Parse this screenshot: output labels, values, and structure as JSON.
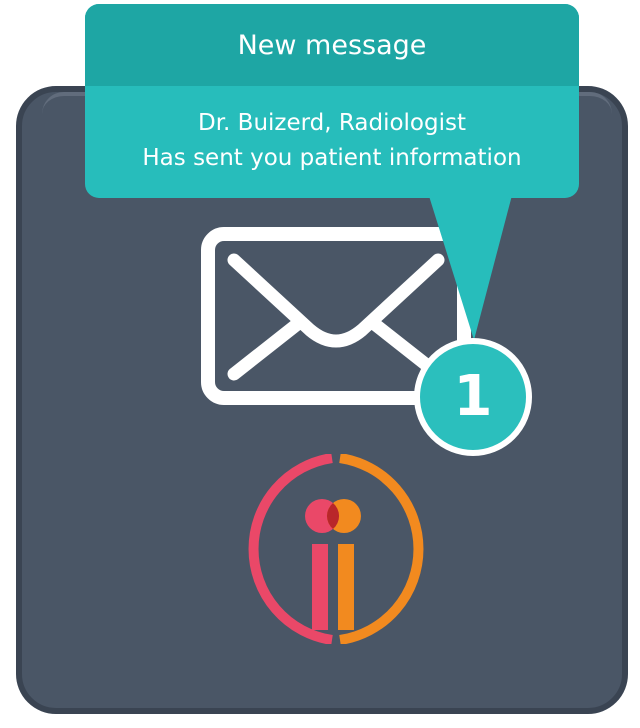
{
  "notification": {
    "title": "New message",
    "sender_line": "Dr. Buizerd, Radiologist",
    "message_line": "Has sent you patient information"
  },
  "badge": {
    "count": "1"
  },
  "icons": {
    "envelope": "envelope-icon",
    "logo": "ii-logo"
  },
  "colors": {
    "tile_background": "#4a5666",
    "bubble_teal": "#27bdbb",
    "bubble_header_teal": "#1ea6a4",
    "badge_teal": "#2bbfbd",
    "logo_pink": "#ea4868",
    "logo_orange": "#f28a1f"
  }
}
